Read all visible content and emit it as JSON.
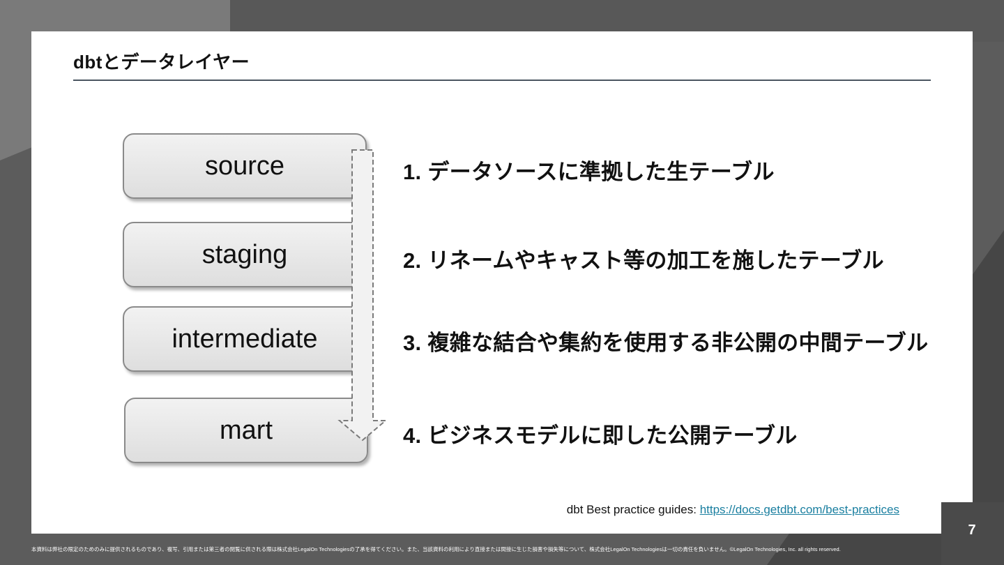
{
  "slide": {
    "title": "dbtとデータレイヤー",
    "page_number": "7"
  },
  "layers": [
    {
      "label": "source",
      "description": "1. データソースに準拠した生テーブル"
    },
    {
      "label": "staging",
      "description": "2. リネームやキャスト等の加工を施したテーブル"
    },
    {
      "label": "intermediate",
      "description": "3. 複雑な結合や集約を使用する非公開の中間テーブル"
    },
    {
      "label": "mart",
      "description": "4. ビジネスモデルに即した公開テーブル"
    }
  ],
  "reference": {
    "prefix": "dbt Best practice guides: ",
    "link_text": "https://docs.getdbt.com/best-practices"
  },
  "disclaimer": "本資料は弊社の限定のためのみに提供されるものであり、複写、引用または第三者の閲覧に供される際は株式会社LegalOn Technologiesの了承を得てください。また、当該資料の利用により直接または間接に生じた損害や損失等について、株式会社LegalOn Technologiesは一切の責任を負いません。©LegalOn Technologies, Inc. all rights reserved.",
  "colors": {
    "background": "#5c5c5c",
    "slide": "#ffffff",
    "title_rule": "#4a5560",
    "link": "#1a7fa0",
    "page_box": "#4a4a4a"
  }
}
